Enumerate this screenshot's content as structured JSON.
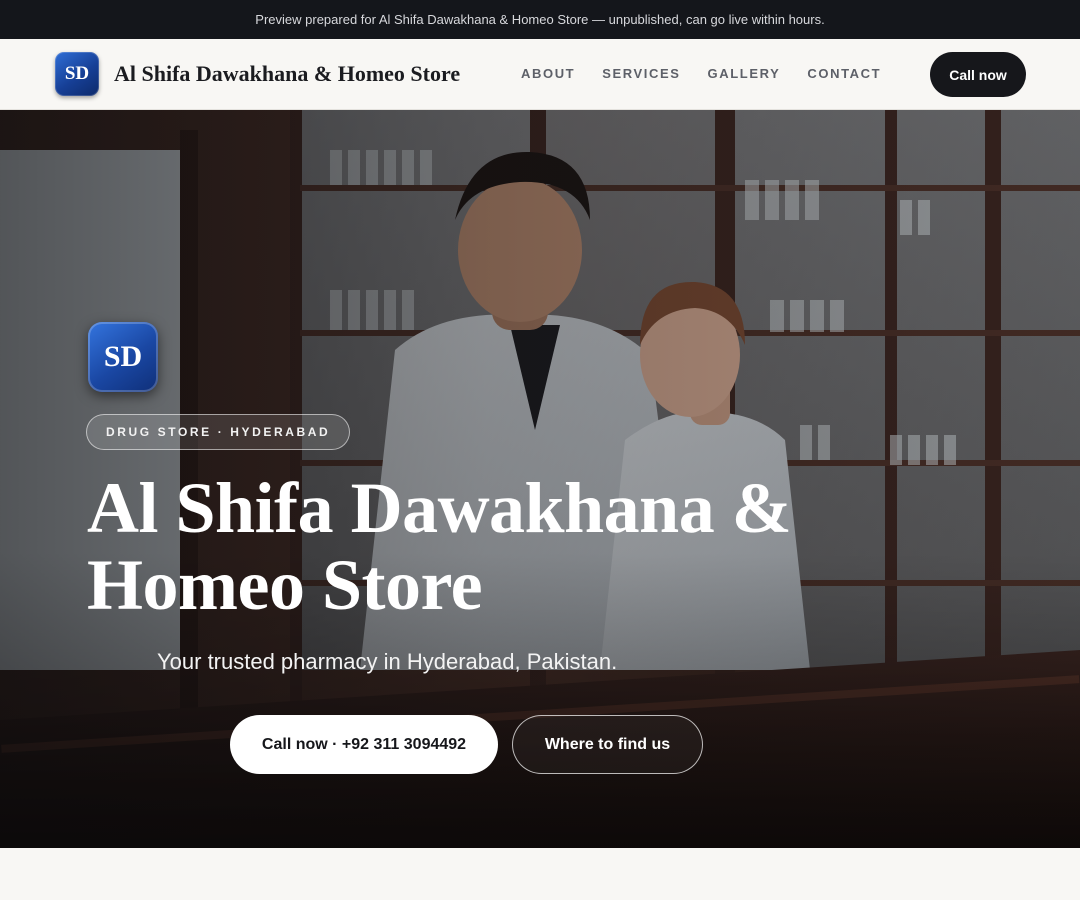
{
  "preview_bar": {
    "text": "Preview prepared for Al Shifa Dawakhana & Homeo Store — unpublished, can go live within hours."
  },
  "nav": {
    "logo_text": "SD",
    "brand": "Al Shifa Dawakhana & Homeo Store",
    "links": [
      "ABOUT",
      "SERVICES",
      "GALLERY",
      "CONTACT"
    ],
    "cta": "Call now"
  },
  "hero": {
    "logo_text": "SD",
    "tag": "DRUG STORE · HYDERABAD",
    "title": "Al Shifa Dawakhana & Homeo Store",
    "subtitle": "Your trusted pharmacy in Hyderabad, Pakistan.",
    "primary_button": "Call now · +92 311 3094492",
    "secondary_button": "Where to find us"
  },
  "colors": {
    "dark": "#14161b",
    "page_bg": "#f8f7f4",
    "logo_blue": "#1a47a3"
  }
}
